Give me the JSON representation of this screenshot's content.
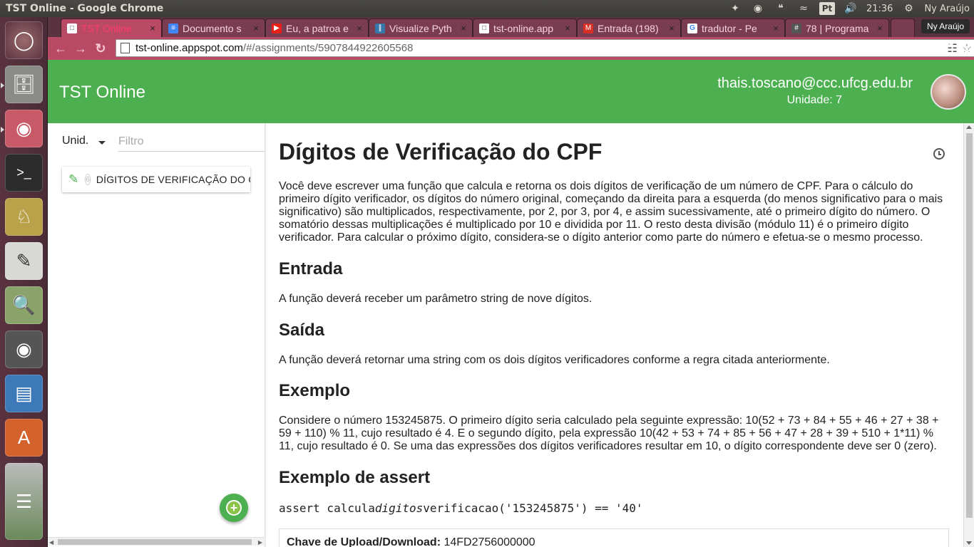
{
  "os_panel": {
    "window_title": "TST Online - Google Chrome",
    "keyboard_layout": "Pt",
    "clock": "21:36",
    "user_name": "Ny Araújo",
    "icons": [
      "dropbox-icon",
      "chrome-icon",
      "hangouts-icon",
      "wifi-icon",
      "keyboard-layout-icon",
      "volume-icon",
      "settings-gear-icon"
    ]
  },
  "launcher": {
    "icons": [
      "ubuntu-dash-icon",
      "files-icon",
      "chrome-icon",
      "terminal-icon",
      "genie-lamp-icon",
      "text-editor-icon",
      "image-viewer-icon",
      "speaker-icon",
      "writer-icon",
      "software-center-icon",
      "stacked-apps-icon"
    ]
  },
  "browser": {
    "tabs": [
      {
        "label": "TST Online",
        "icon": "page-icon",
        "color": "#ffffff",
        "active": true
      },
      {
        "label": "Documento s",
        "icon": "docs-icon",
        "color": "#4285f4",
        "active": false
      },
      {
        "label": "Eu, a patroa e",
        "icon": "youtube-icon",
        "color": "#e62117",
        "active": false
      },
      {
        "label": "Visualize Pyth",
        "icon": "python-icon",
        "color": "#3776ab",
        "active": false
      },
      {
        "label": "tst-online.app",
        "icon": "page-icon",
        "color": "#ffffff",
        "active": false
      },
      {
        "label": "Entrada (198)",
        "icon": "gmail-icon",
        "color": "#d93025",
        "active": false
      },
      {
        "label": "tradutor - Pe",
        "icon": "google-icon",
        "color": "#4285f4",
        "active": false
      },
      {
        "label": "78 | Programa",
        "icon": "hash-icon",
        "color": "#555555",
        "active": false
      }
    ],
    "profile_name": "Ny Araújo",
    "url_host": "tst-online.appspot.com",
    "url_path": "/#/assignments/5907844922605568"
  },
  "app": {
    "title": "TST Online",
    "user_email": "thais.toscano@ccc.ufcg.edu.br",
    "user_unit": "Unidade: 7",
    "accent_color": "#4caf50"
  },
  "sidebar": {
    "unit_select": "Unid.",
    "filter_placeholder": "Filtro",
    "assignments": [
      {
        "number": "6",
        "label": "DÍGITOS DE VERIFICAÇÃO DO CPF"
      }
    ]
  },
  "assignment": {
    "title": "Dígitos de Verificação do CPF",
    "description": "Você deve escrever uma função que calcula e retorna os dois dígitos de verificação de um número de CPF. Para o cálculo do primeiro dígito verificador, os dígitos do número original, começando da direita para a esquerda (do menos significativo para o mais significativo) são multiplicados, respectivamente, por 2, por 3, por 4, e assim sucessivamente, até o primeiro dígito do número. O somatório dessas multiplicações é multiplicado por 10 e dividida por 11. O resto desta divisão (módulo 11) é o primeiro dígito verificador. Para calcular o próximo dígito, considera-se o dígito anterior como parte do número e efetua-se o mesmo processo.",
    "input_heading": "Entrada",
    "input_text": "A função deverá receber um parâmetro string de nove dígitos.",
    "output_heading": "Saída",
    "output_text": "A função deverá retornar uma string com os dois dígitos verificadores conforme a regra citada anteriormente.",
    "example_heading": "Exemplo",
    "example_text": "Considere o número 153245875. O primeiro dígito seria calculado pela seguinte expressão: 10(52 + 73 + 84 + 55 + 46 + 27 + 38 + 59 + 110) % 11, cujo resultado é 4. E o segundo dígito, pela expressão 10(42 + 53 + 74 + 85 + 56 + 47 + 28 + 39 + 510 + 1*11) % 11, cujo resultado é 0. Se uma das expressões dos dígitos verificadores resultar em 10, o dígito correspondente deve ser 0 (zero).",
    "assert_heading": "Exemplo de assert",
    "assert_prefix": "assert calcula",
    "assert_italic": "digitos",
    "assert_suffix": "verificacao('153245875') == '40'",
    "upload_label": "Chave de Upload/Download:",
    "upload_key": "14FD2756000000"
  }
}
